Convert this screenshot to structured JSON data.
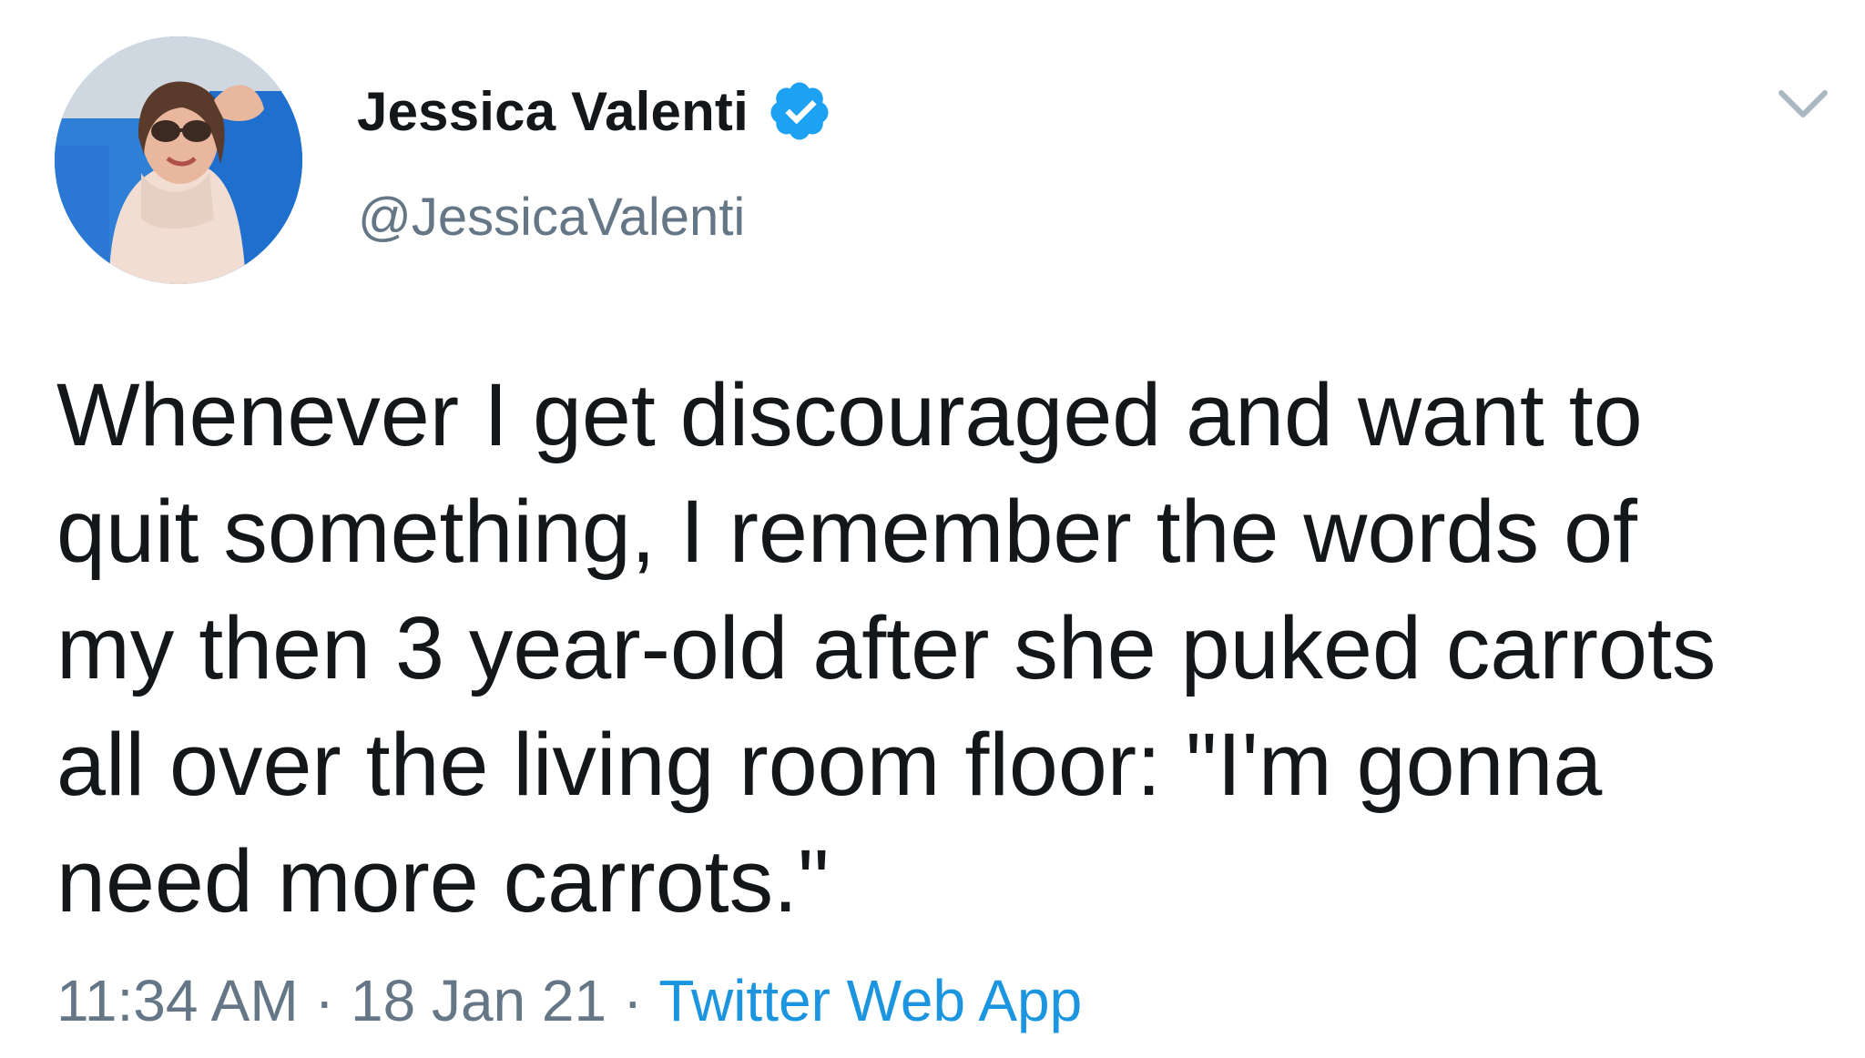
{
  "tweet": {
    "author": {
      "display_name": "Jessica Valenti",
      "handle": "@JessicaValenti",
      "verified": true
    },
    "text": "Whenever I get discouraged and want to\nquit something, I remember the words of\nmy then 3 year-old after she puked carrots\nall over the living room floor: \"I'm gonna\nneed more carrots.\"",
    "time": "11:34 AM",
    "date": "18 Jan 21",
    "separator": "·",
    "source": "Twitter Web App"
  },
  "icons": {
    "verified": "verified-badge-icon",
    "menu": "chevron-down-icon"
  },
  "colors": {
    "text_primary": "#14171a",
    "text_secondary": "#657786",
    "link": "#1b95e0",
    "verified": "#1da1f2"
  }
}
